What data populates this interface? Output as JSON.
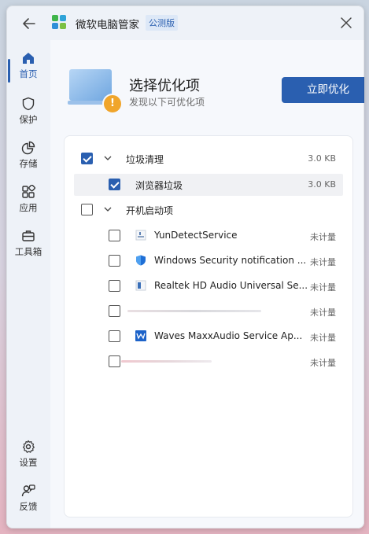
{
  "app": {
    "title": "微软电脑管家",
    "badge": "公测版"
  },
  "sidebar": {
    "items": [
      {
        "label": "首页",
        "icon": "home-icon",
        "active": true
      },
      {
        "label": "保护",
        "icon": "shield-icon"
      },
      {
        "label": "存储",
        "icon": "pie-chart-icon"
      },
      {
        "label": "应用",
        "icon": "apps-icon"
      },
      {
        "label": "工具箱",
        "icon": "toolbox-icon"
      }
    ],
    "bottom_items": [
      {
        "label": "设置",
        "icon": "gear-icon"
      },
      {
        "label": "反馈",
        "icon": "feedback-icon"
      }
    ]
  },
  "header": {
    "title": "选择优化项",
    "subtitle": "发现以下可优化项",
    "primary_button": "立即优化",
    "warning_symbol": "!"
  },
  "list": {
    "groups": [
      {
        "label": "垃圾清理",
        "size": "3.0 KB",
        "checked": true,
        "expanded": true,
        "items": [
          {
            "label": "浏览器垃圾",
            "size": "3.0 KB",
            "checked": true
          }
        ]
      },
      {
        "label": "开机启动项",
        "checked": false,
        "expanded": true,
        "items": [
          {
            "label": "YunDetectService",
            "size": "未计量",
            "checked": false
          },
          {
            "label": "Windows Security notification ...",
            "size": "未计量",
            "checked": false
          },
          {
            "label": "Realtek HD Audio Universal Se...",
            "size": "未计量",
            "checked": false
          },
          {
            "label": "",
            "size": "未计量",
            "checked": false
          },
          {
            "label": "Waves MaxxAudio Service Ap...",
            "size": "未计量",
            "checked": false
          },
          {
            "label": "",
            "size": "未计量",
            "checked": false
          }
        ]
      }
    ]
  },
  "colors": {
    "accent": "#2a5fb0",
    "warning": "#f0a52b"
  }
}
